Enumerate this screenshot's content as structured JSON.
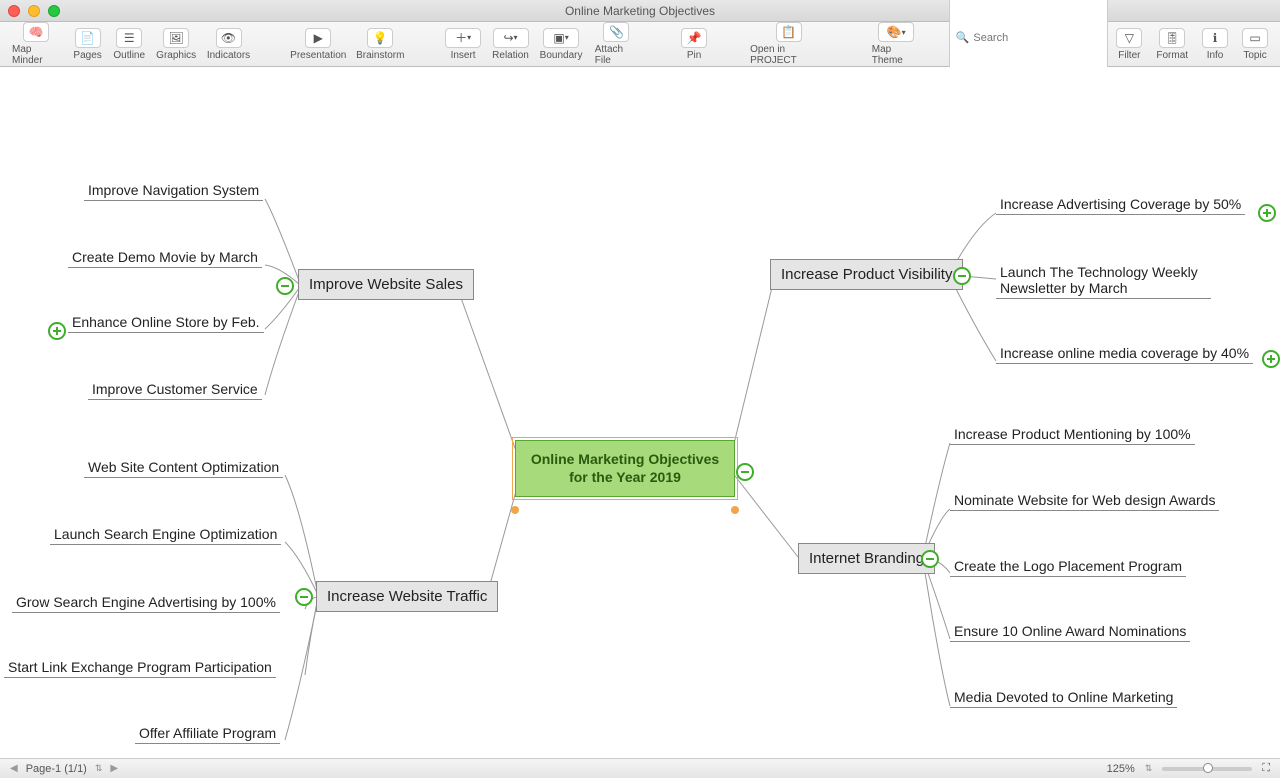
{
  "window": {
    "title": "Online Marketing Objectives"
  },
  "toolbar": {
    "map_minder": "Map Minder",
    "pages": "Pages",
    "outline": "Outline",
    "graphics": "Graphics",
    "indicators": "Indicators",
    "presentation": "Presentation",
    "brainstorm": "Brainstorm",
    "insert": "Insert",
    "relation": "Relation",
    "boundary": "Boundary",
    "attach_file": "Attach File",
    "pin": "Pin",
    "open_in_project": "Open in PROJECT",
    "map_theme": "Map Theme",
    "search_label": "Search",
    "search_placeholder": "Search",
    "filter": "Filter",
    "format": "Format",
    "info": "Info",
    "topic": "Topic"
  },
  "mindmap": {
    "center": "Online Marketing Objectives for the Year 2019",
    "branches": {
      "improve_sales": {
        "label": "Improve Website Sales",
        "children": [
          "Improve Navigation System",
          "Create Demo Movie by March",
          "Enhance Online Store by Feb.",
          "Improve Customer Service"
        ]
      },
      "increase_traffic": {
        "label": "Increase Website Traffic",
        "children": [
          "Web Site Content Optimization",
          "Launch Search Engine Optimization",
          "Grow Search Engine Advertising by 100%",
          "Start Link Exchange Program Participation",
          "Offer Affiliate Program"
        ]
      },
      "product_visibility": {
        "label": "Increase Product Visibility",
        "children": [
          "Increase Advertising Coverage by 50%",
          "Launch The Technology Weekly Newsletter by March",
          "Increase online media coverage by 40%"
        ]
      },
      "internet_branding": {
        "label": "Internet Branding",
        "children": [
          "Increase Product Mentioning by 100%",
          "Nominate Website for Web design Awards",
          "Create the Logo Placement Program",
          "Ensure 10 Online Award Nominations",
          "Media Devoted to Online Marketing"
        ]
      }
    }
  },
  "status": {
    "page": "Page-1 (1/1)",
    "zoom": "125%"
  }
}
